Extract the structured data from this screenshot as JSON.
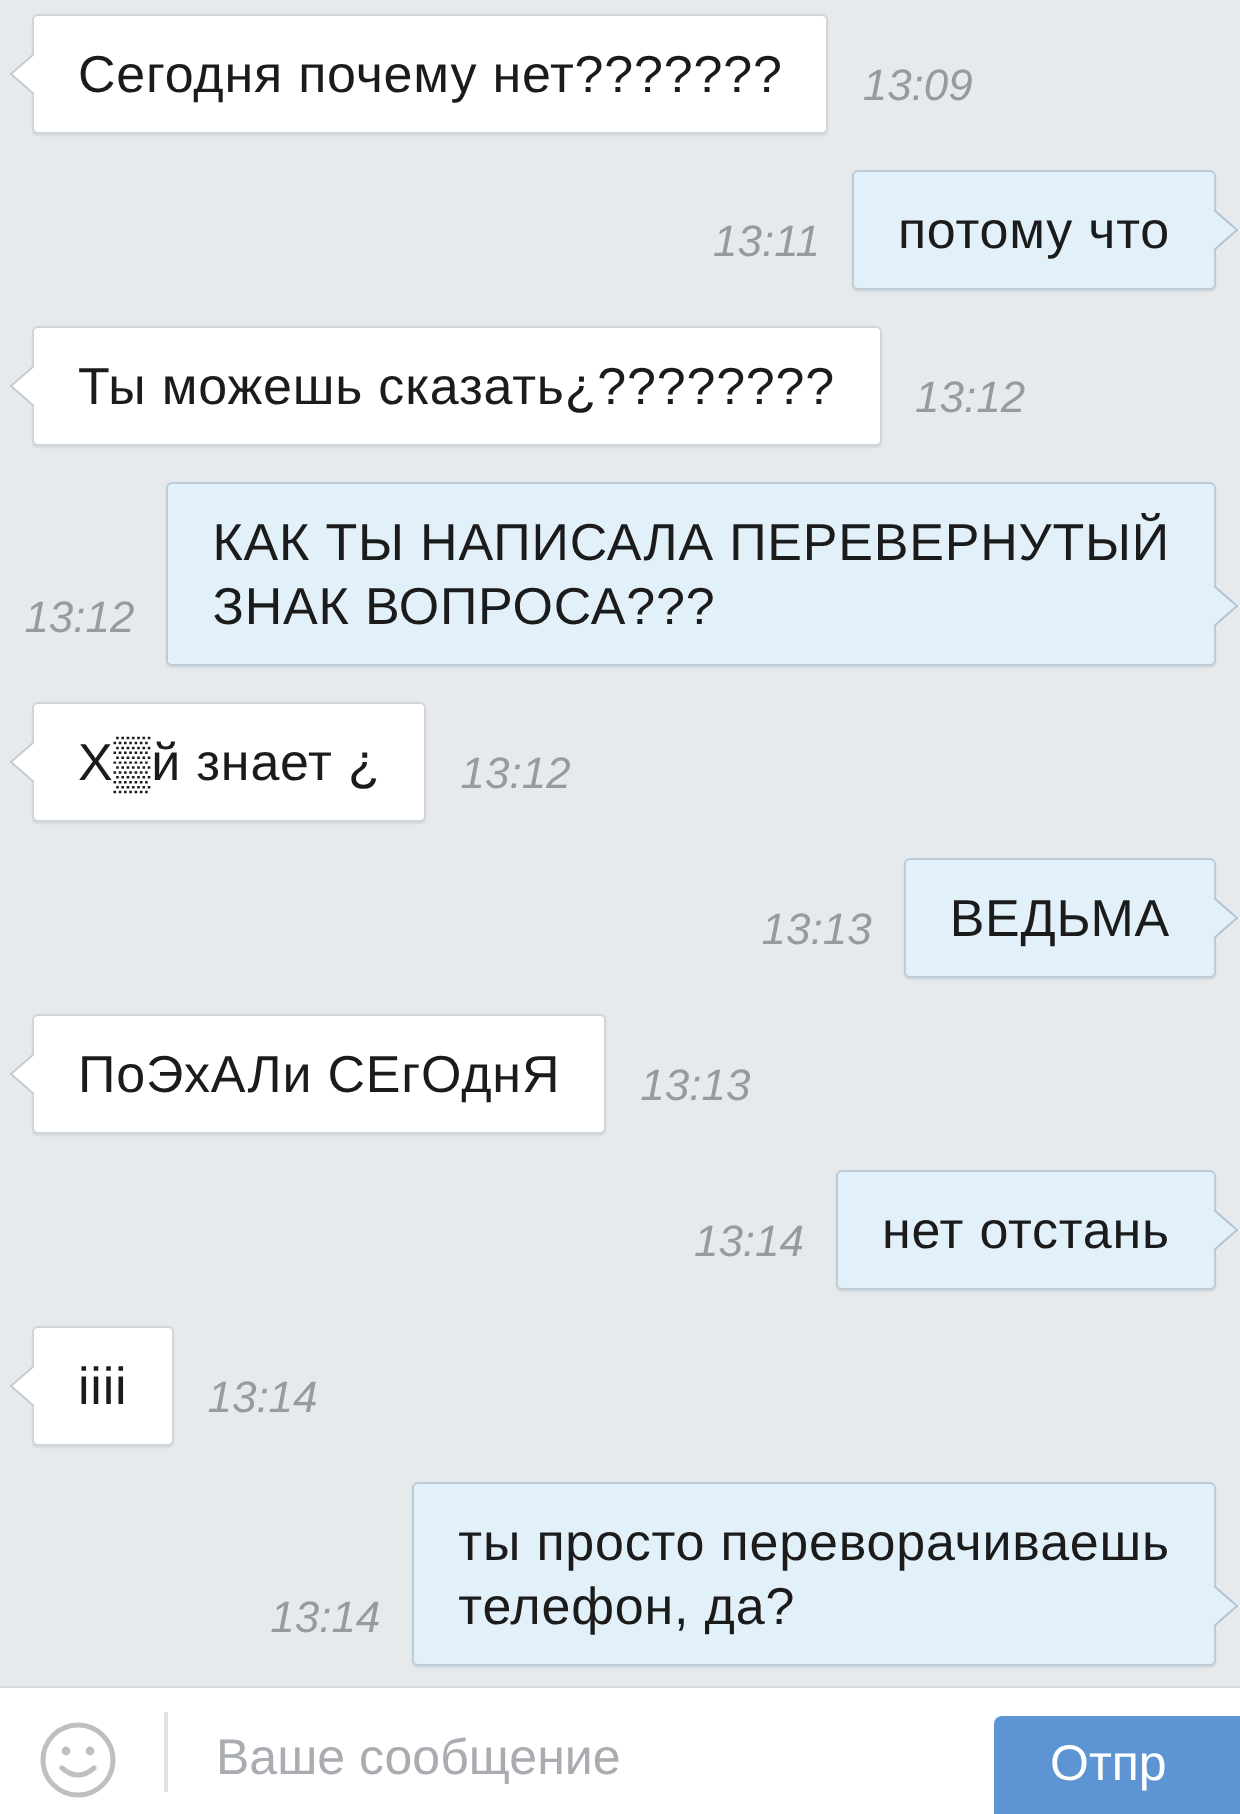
{
  "messages": [
    {
      "kind": "incoming",
      "text": "Сегодня почему нет???????",
      "time": "13:09"
    },
    {
      "kind": "outgoing",
      "text": "потому что",
      "time": "13:11"
    },
    {
      "kind": "incoming",
      "text": "Ты можешь сказать¿????????",
      "time": "13:12"
    },
    {
      "kind": "outgoing",
      "text": "КАК ТЫ НАПИСАЛА ПЕРЕВЕРНУТЫЙ\nЗНАК ВОПРОСА???",
      "time": "13:12"
    },
    {
      "kind": "incoming",
      "text": "Х▒й знает ¿",
      "time": "13:12"
    },
    {
      "kind": "outgoing",
      "text": "ВЕДЬМА",
      "time": "13:13"
    },
    {
      "kind": "incoming",
      "text": "ПоЭхАЛи СЕгОднЯ",
      "time": "13:13"
    },
    {
      "kind": "outgoing",
      "text": "нет отстань",
      "time": "13:14"
    },
    {
      "kind": "incoming",
      "text": "iiii",
      "time": "13:14"
    },
    {
      "kind": "outgoing",
      "text": "ты просто переворачиваешь\nтелефон, да?",
      "time": "13:14"
    }
  ],
  "composer": {
    "placeholder": "Ваше сообщение",
    "send_button": "Отпр"
  }
}
